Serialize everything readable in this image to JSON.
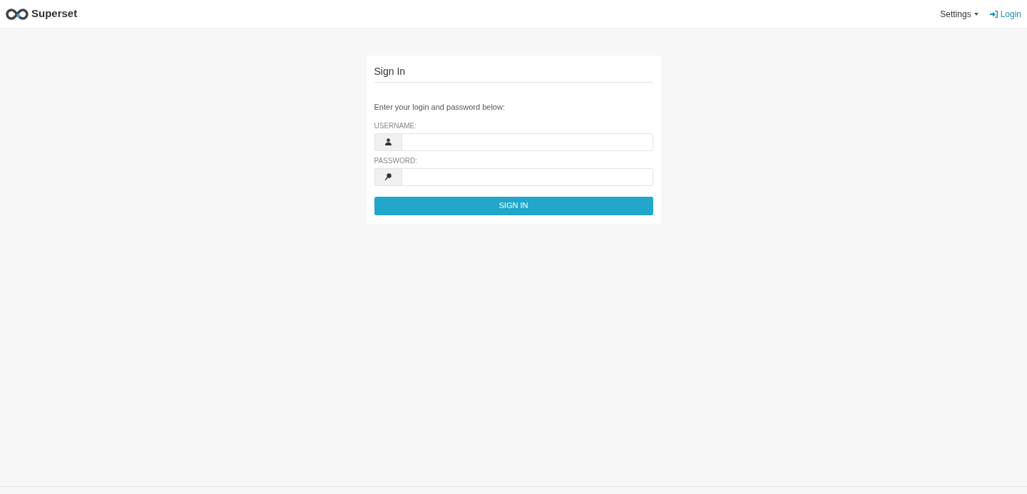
{
  "navbar": {
    "brand": "Superset",
    "menu": [
      {
        "label": "Settings",
        "kind": "dropdown"
      },
      {
        "label": "Login",
        "kind": "login"
      }
    ]
  },
  "login_panel": {
    "title": "Sign In",
    "instructions": "Enter your login and password below:",
    "fields": [
      {
        "label": "USERNAME:",
        "kind": "user"
      },
      {
        "label": "PASSWORD:",
        "kind": "password"
      }
    ],
    "submit": "SIGN IN"
  }
}
